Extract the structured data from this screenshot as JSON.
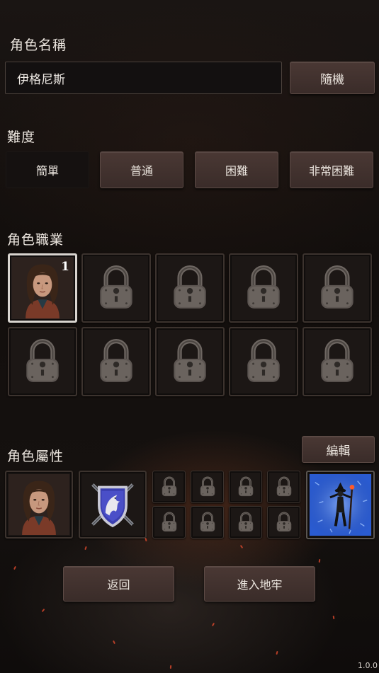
{
  "name_section": {
    "label": "角色名稱",
    "value": "伊格尼斯",
    "random_label": "隨機"
  },
  "difficulty": {
    "label": "難度",
    "options": [
      "簡單",
      "普通",
      "困難",
      "非常困難"
    ],
    "selected": "簡單"
  },
  "class_section": {
    "label": "角色職業",
    "active_level": "1",
    "active_icon": "character-portrait-icon",
    "locked_icon": "padlock-icon"
  },
  "attributes": {
    "label": "角色屬性",
    "edit_label": "編輯",
    "portrait_icon": "character-portrait-icon",
    "emblem_icon": "griffin-shield-emblem-icon",
    "skill_icon": "mage-silhouette-skill-icon"
  },
  "footer": {
    "back_label": "返回",
    "enter_label": "進入地牢",
    "version": "1.0.0"
  },
  "colors": {
    "button": "#3f302d",
    "selected_button": "#151110",
    "slot_border": "#3c332e",
    "skill_bg": "#2b5bbf",
    "ember": "#d2472b"
  }
}
